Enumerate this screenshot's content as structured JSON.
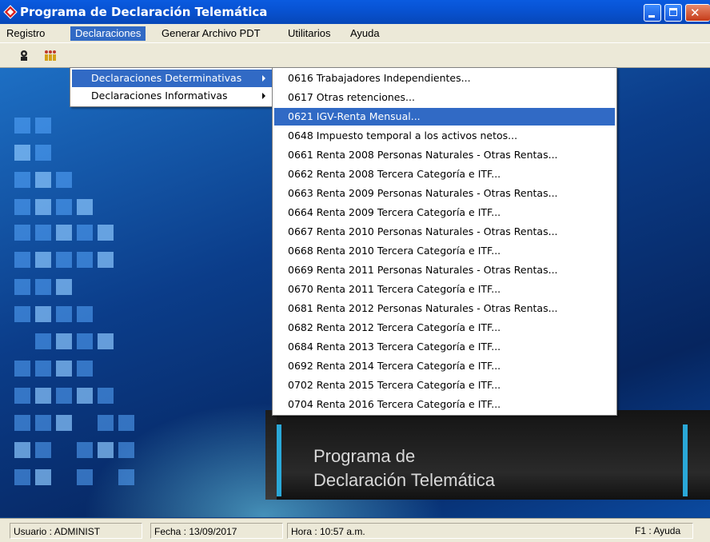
{
  "window": {
    "title": "Programa de Declaración Telemática"
  },
  "menubar": [
    {
      "label": "Registro"
    },
    {
      "label": "Declaraciones"
    },
    {
      "label": "Generar Archivo PDT"
    },
    {
      "label": "Utilitarios"
    },
    {
      "label": "Ayuda"
    }
  ],
  "submenu_declaraciones": [
    {
      "label": "Declaraciones Determinativas"
    },
    {
      "label": "Declaraciones Informativas"
    }
  ],
  "submenu_determinativas": [
    {
      "label": "0616 Trabajadores Independientes..."
    },
    {
      "label": "0617 Otras retenciones..."
    },
    {
      "label": "0621 IGV-Renta Mensual..."
    },
    {
      "label": "0648 Impuesto temporal a los activos netos..."
    },
    {
      "label": "0661 Renta 2008 Personas Naturales - Otras Rentas..."
    },
    {
      "label": "0662 Renta 2008 Tercera Categoría e ITF..."
    },
    {
      "label": "0663 Renta 2009 Personas Naturales - Otras Rentas..."
    },
    {
      "label": "0664 Renta 2009 Tercera Categoría e ITF..."
    },
    {
      "label": "0667 Renta 2010 Personas Naturales - Otras Rentas..."
    },
    {
      "label": "0668 Renta 2010 Tercera Categoría e ITF..."
    },
    {
      "label": "0669 Renta 2011 Personas Naturales - Otras Rentas..."
    },
    {
      "label": "0670 Renta 2011 Tercera Categoría e ITF..."
    },
    {
      "label": "0681 Renta 2012 Personas Naturales - Otras Rentas..."
    },
    {
      "label": "0682 Renta 2012 Tercera Categoría e ITF..."
    },
    {
      "label": "0684 Renta 2013 Tercera Categoría e ITF..."
    },
    {
      "label": "0692 Renta 2014 Tercera Categoría e ITF..."
    },
    {
      "label": "0702 Renta 2015 Tercera Categoría e ITF..."
    },
    {
      "label": "0704 Renta 2016 Tercera Categoría e ITF..."
    }
  ],
  "banner": {
    "line1": "Programa de",
    "line2": "Declaración Telemática"
  },
  "statusbar": {
    "usuario": "Usuario : ADMINIST",
    "fecha": "Fecha : 13/09/2017",
    "hora": "Hora : 10:57 a.m.",
    "ayuda": "F1 : Ayuda"
  },
  "colors": {
    "selection": "#316ac5",
    "titlebar": "#0853d3",
    "accent": "#2aa8d8"
  },
  "icons": [
    "app-logo-icon",
    "minimize-icon",
    "maximize-icon",
    "close-icon",
    "settings-person-icon",
    "users-icon",
    "submenu-arrow-icon"
  ]
}
